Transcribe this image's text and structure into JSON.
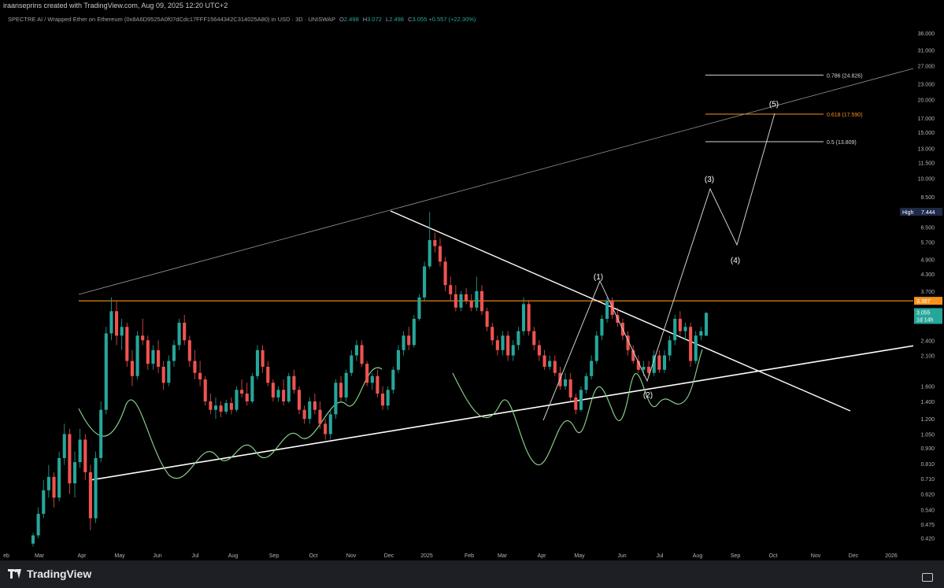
{
  "header": {
    "caption": "iraanseprins created with TradingView.com, Aug 09, 2025 12:20 UTC+2"
  },
  "legend": {
    "symbol": "SPECTRE AI / Wrapped Ether on Ethereum (0x8A6D9525A0f07dCdc17FFF15644342C314025A80) in USD · 3D · UNISWAP",
    "o_label": "O",
    "o": "2.498",
    "h_label": "H",
    "h": "3.072",
    "l_label": "L",
    "l": "2.498",
    "c_label": "C",
    "c": "3.055",
    "change": "+0.557 (+22.30%)"
  },
  "colors": {
    "up": "#26a69a",
    "down": "#ef5350",
    "resistance": "#f7931a",
    "oscillator": "#86c985",
    "fib": "#d1d4dc",
    "fib_highlight": "#f7931a"
  },
  "chart_data": {
    "type": "candlestick",
    "y_scale": "log",
    "ylim": [
      0.38,
      38
    ],
    "x_axis": [
      "eb",
      "Mar",
      "Apr",
      "May",
      "Jun",
      "Jul",
      "Aug",
      "Sep",
      "Oct",
      "Nov",
      "Dec",
      "2025",
      "Feb",
      "Mar",
      "Apr",
      "May",
      "Jun",
      "Jul",
      "Aug",
      "Sep",
      "Oct",
      "Nov",
      "Dec",
      "2026"
    ],
    "y_ticks": [
      "36.000",
      "31.000",
      "27.000",
      "23.000",
      "20.000",
      "17.000",
      "15.000",
      "13.000",
      "11.500",
      "10.000",
      "8.500",
      "7.444",
      "6.500",
      "5.700",
      "4.900",
      "4.300",
      "3.700",
      "3.397",
      "3.055",
      "2.400",
      "2.100",
      "1.600",
      "1.400",
      "1.200",
      "1.050",
      "0.930",
      "0.810",
      "0.710",
      "0.620",
      "0.540",
      "0.475",
      "0.420"
    ],
    "y_tick_values": [
      36,
      31,
      27,
      23,
      20,
      17,
      15,
      13,
      11.5,
      10,
      8.5,
      7.444,
      6.5,
      5.7,
      4.9,
      4.3,
      3.7,
      3.397,
      3.055,
      2.4,
      2.1,
      1.6,
      1.4,
      1.2,
      1.05,
      0.93,
      0.81,
      0.71,
      0.62,
      0.54,
      0.475,
      0.42
    ],
    "price_labels": {
      "high_label": "High",
      "high_value": "7.444",
      "resistance_value": "3.397",
      "last_value": "3.055",
      "countdown": "1d 14h"
    },
    "fib_levels": [
      {
        "label": "0.786 (24.826)",
        "value": 24.826,
        "highlight": false
      },
      {
        "label": "0.618 (17.590)",
        "value": 17.59,
        "highlight": true
      },
      {
        "label": "0.5 (13.809)",
        "value": 13.809,
        "highlight": false
      }
    ],
    "wave_labels": [
      {
        "label": "(1)",
        "value": 4.1
      },
      {
        "label": "(2)",
        "value": 1.45
      },
      {
        "label": "(3)",
        "value": 9.7
      },
      {
        "label": "(4)",
        "value": 4.75
      },
      {
        "label": "(5)",
        "value": 18.8
      }
    ],
    "candles": [
      [
        0.4,
        0.44,
        0.39,
        0.43
      ],
      [
        0.43,
        0.55,
        0.42,
        0.52
      ],
      [
        0.52,
        0.7,
        0.5,
        0.64
      ],
      [
        0.64,
        0.8,
        0.6,
        0.72
      ],
      [
        0.72,
        0.75,
        0.55,
        0.6
      ],
      [
        0.6,
        0.9,
        0.58,
        0.85
      ],
      [
        0.85,
        1.15,
        0.8,
        1.05
      ],
      [
        1.05,
        1.1,
        0.62,
        0.68
      ],
      [
        0.68,
        0.9,
        0.6,
        0.82
      ],
      [
        0.82,
        1.1,
        0.78,
        1.0
      ],
      [
        1.0,
        1.05,
        0.7,
        0.75
      ],
      [
        0.75,
        0.8,
        0.45,
        0.5
      ],
      [
        0.5,
        0.9,
        0.48,
        0.85
      ],
      [
        0.85,
        1.4,
        0.82,
        1.3
      ],
      [
        1.3,
        2.7,
        1.25,
        2.55
      ],
      [
        2.55,
        3.5,
        2.4,
        3.1
      ],
      [
        3.1,
        3.4,
        2.3,
        2.5
      ],
      [
        2.5,
        2.9,
        2.2,
        2.7
      ],
      [
        2.7,
        2.8,
        1.9,
        2.0
      ],
      [
        2.0,
        2.2,
        1.6,
        1.75
      ],
      [
        1.75,
        2.6,
        1.7,
        2.5
      ],
      [
        2.5,
        2.9,
        2.3,
        2.4
      ],
      [
        2.4,
        2.5,
        1.85,
        1.95
      ],
      [
        1.95,
        2.3,
        1.85,
        2.2
      ],
      [
        2.2,
        2.4,
        1.8,
        1.9
      ],
      [
        1.9,
        2.0,
        1.55,
        1.65
      ],
      [
        1.65,
        2.1,
        1.6,
        2.0
      ],
      [
        2.0,
        2.4,
        1.9,
        2.3
      ],
      [
        2.3,
        2.9,
        2.2,
        2.8
      ],
      [
        2.8,
        3.0,
        2.3,
        2.4
      ],
      [
        2.4,
        2.5,
        1.9,
        2.0
      ],
      [
        2.0,
        2.2,
        1.7,
        1.8
      ],
      [
        1.8,
        2.0,
        1.6,
        1.7
      ],
      [
        1.7,
        1.75,
        1.35,
        1.4
      ],
      [
        1.4,
        1.5,
        1.25,
        1.3
      ],
      [
        1.3,
        1.45,
        1.2,
        1.35
      ],
      [
        1.35,
        1.4,
        1.22,
        1.28
      ],
      [
        1.28,
        1.42,
        1.25,
        1.38
      ],
      [
        1.38,
        1.45,
        1.25,
        1.3
      ],
      [
        1.3,
        1.6,
        1.28,
        1.55
      ],
      [
        1.55,
        1.7,
        1.45,
        1.5
      ],
      [
        1.5,
        1.65,
        1.35,
        1.4
      ],
      [
        1.4,
        1.8,
        1.38,
        1.75
      ],
      [
        1.75,
        2.3,
        1.7,
        2.2
      ],
      [
        2.2,
        2.3,
        1.8,
        1.9
      ],
      [
        1.9,
        2.0,
        1.6,
        1.65
      ],
      [
        1.65,
        1.7,
        1.4,
        1.45
      ],
      [
        1.45,
        1.6,
        1.4,
        1.55
      ],
      [
        1.55,
        1.7,
        1.35,
        1.4
      ],
      [
        1.4,
        1.8,
        1.38,
        1.75
      ],
      [
        1.75,
        1.85,
        1.5,
        1.55
      ],
      [
        1.55,
        1.6,
        1.25,
        1.3
      ],
      [
        1.3,
        1.35,
        1.15,
        1.2
      ],
      [
        1.2,
        1.45,
        1.15,
        1.4
      ],
      [
        1.4,
        1.5,
        1.25,
        1.3
      ],
      [
        1.3,
        1.4,
        1.1,
        1.15
      ],
      [
        1.15,
        1.2,
        1.0,
        1.05
      ],
      [
        1.05,
        1.3,
        1.0,
        1.25
      ],
      [
        1.25,
        1.7,
        1.2,
        1.65
      ],
      [
        1.65,
        1.75,
        1.4,
        1.45
      ],
      [
        1.45,
        1.85,
        1.4,
        1.8
      ],
      [
        1.8,
        2.2,
        1.75,
        2.1
      ],
      [
        2.1,
        2.4,
        2.0,
        2.3
      ],
      [
        2.3,
        2.4,
        1.9,
        1.95
      ],
      [
        1.95,
        2.0,
        1.6,
        1.65
      ],
      [
        1.65,
        1.8,
        1.55,
        1.75
      ],
      [
        1.75,
        1.85,
        1.45,
        1.5
      ],
      [
        1.5,
        1.6,
        1.3,
        1.35
      ],
      [
        1.35,
        1.6,
        1.3,
        1.55
      ],
      [
        1.55,
        1.9,
        1.5,
        1.85
      ],
      [
        1.85,
        2.3,
        1.8,
        2.2
      ],
      [
        2.2,
        2.6,
        2.1,
        2.5
      ],
      [
        2.5,
        2.7,
        2.2,
        2.3
      ],
      [
        2.3,
        3.0,
        2.25,
        2.9
      ],
      [
        2.9,
        3.6,
        2.85,
        3.5
      ],
      [
        3.5,
        4.8,
        3.4,
        4.6
      ],
      [
        4.6,
        7.44,
        4.5,
        5.8
      ],
      [
        5.8,
        6.2,
        5.2,
        5.5
      ],
      [
        5.5,
        5.9,
        4.6,
        4.8
      ],
      [
        4.8,
        5.0,
        3.7,
        3.9
      ],
      [
        3.9,
        4.2,
        3.4,
        3.6
      ],
      [
        3.6,
        3.9,
        3.1,
        3.2
      ],
      [
        3.2,
        3.7,
        3.1,
        3.6
      ],
      [
        3.6,
        3.8,
        3.3,
        3.4
      ],
      [
        3.4,
        3.6,
        3.1,
        3.2
      ],
      [
        3.2,
        4.2,
        3.1,
        3.7
      ],
      [
        3.7,
        3.9,
        3.0,
        3.1
      ],
      [
        3.1,
        3.2,
        2.6,
        2.7
      ],
      [
        2.7,
        2.8,
        2.3,
        2.4
      ],
      [
        2.4,
        2.5,
        2.1,
        2.2
      ],
      [
        2.2,
        2.6,
        2.1,
        2.5
      ],
      [
        2.5,
        2.6,
        2.0,
        2.1
      ],
      [
        2.1,
        2.4,
        2.0,
        2.3
      ],
      [
        2.3,
        2.7,
        2.2,
        2.6
      ],
      [
        2.6,
        3.5,
        2.5,
        3.3
      ],
      [
        3.3,
        3.4,
        2.5,
        2.6
      ],
      [
        2.6,
        2.7,
        2.2,
        2.3
      ],
      [
        2.3,
        2.4,
        2.0,
        2.1
      ],
      [
        2.1,
        2.2,
        1.85,
        1.9
      ],
      [
        1.9,
        2.1,
        1.85,
        2.0
      ],
      [
        2.0,
        2.1,
        1.75,
        1.8
      ],
      [
        1.8,
        1.9,
        1.55,
        1.6
      ],
      [
        1.6,
        1.8,
        1.55,
        1.7
      ],
      [
        1.7,
        1.8,
        1.4,
        1.45
      ],
      [
        1.45,
        1.5,
        1.25,
        1.3
      ],
      [
        1.3,
        1.6,
        1.28,
        1.55
      ],
      [
        1.55,
        1.8,
        1.5,
        1.75
      ],
      [
        1.75,
        2.1,
        1.7,
        2.0
      ],
      [
        2.0,
        2.6,
        1.95,
        2.5
      ],
      [
        2.5,
        3.0,
        2.4,
        2.9
      ],
      [
        2.9,
        3.5,
        2.8,
        3.4
      ],
      [
        3.4,
        3.5,
        2.9,
        3.0
      ],
      [
        3.0,
        3.2,
        2.7,
        2.8
      ],
      [
        2.8,
        2.9,
        2.4,
        2.5
      ],
      [
        2.5,
        2.6,
        2.1,
        2.2
      ],
      [
        2.2,
        2.3,
        1.95,
        2.0
      ],
      [
        2.0,
        2.1,
        1.8,
        1.85
      ],
      [
        1.85,
        2.0,
        1.75,
        1.9
      ],
      [
        1.9,
        2.0,
        1.75,
        1.8
      ],
      [
        1.8,
        2.2,
        1.75,
        2.1
      ],
      [
        2.1,
        2.2,
        1.8,
        1.85
      ],
      [
        1.85,
        2.2,
        1.8,
        2.1
      ],
      [
        2.1,
        2.5,
        2.0,
        2.4
      ],
      [
        2.4,
        3.0,
        2.3,
        2.9
      ],
      [
        2.9,
        3.1,
        2.5,
        2.6
      ],
      [
        2.6,
        2.8,
        2.4,
        2.7
      ],
      [
        2.7,
        2.8,
        1.9,
        2.0
      ],
      [
        2.0,
        2.6,
        1.95,
        2.5
      ],
      [
        2.5,
        2.7,
        2.4,
        2.6
      ],
      [
        2.498,
        3.072,
        2.498,
        3.055
      ]
    ]
  }
}
